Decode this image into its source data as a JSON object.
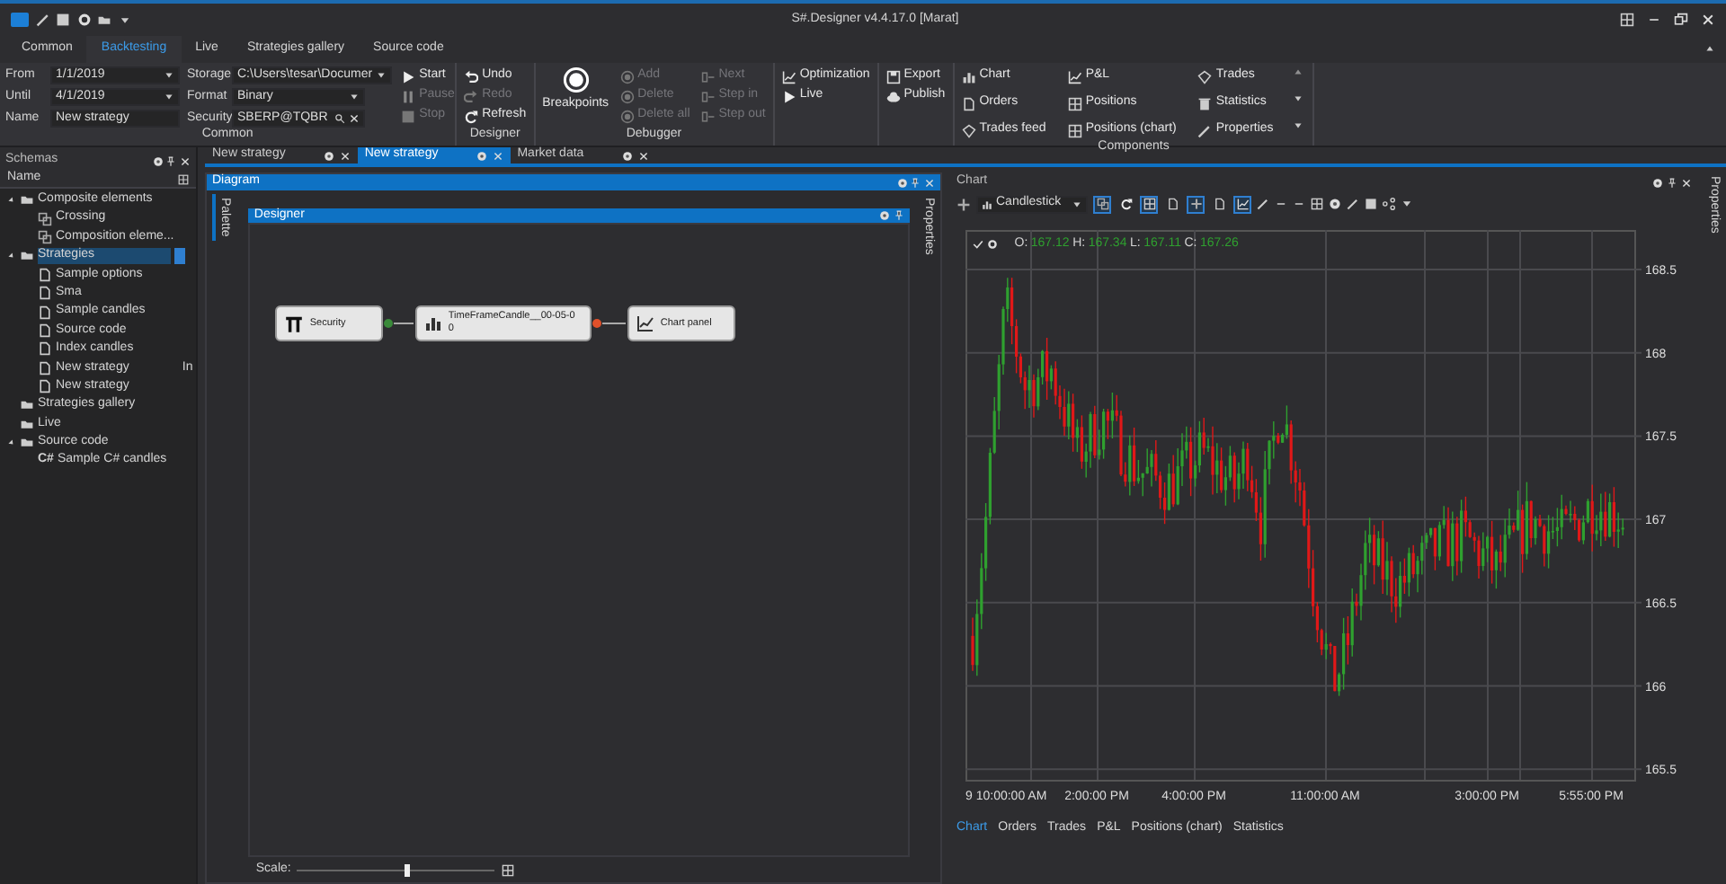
{
  "window": {
    "title": "S#.Designer v4.4.17.0 [Marat]"
  },
  "ribbon_tabs": [
    {
      "label": "Common",
      "selected": false
    },
    {
      "label": "Backtesting",
      "selected": true
    },
    {
      "label": "Live",
      "selected": false
    },
    {
      "label": "Strategies gallery",
      "selected": false
    },
    {
      "label": "Source code",
      "selected": false
    }
  ],
  "ribbon_groups": [
    {
      "kind": "common",
      "title": "Common",
      "fields": [
        {
          "label": "From",
          "value": "1/1/2019",
          "kind": "dropdown"
        },
        {
          "label": "Until",
          "value": "4/1/2019",
          "kind": "dropdown"
        },
        {
          "label": "Name",
          "value": "New strategy",
          "kind": "text"
        },
        {
          "label": "Storage",
          "value": "C:\\Users\\tesar\\Documer",
          "kind": "dropdown"
        },
        {
          "label": "Format",
          "value": "Binary",
          "kind": "dropdown"
        },
        {
          "label": "Security",
          "value": "SBERP@TQBR",
          "kind": "search"
        }
      ],
      "buttons": [
        {
          "label": "Start",
          "disabled": false
        },
        {
          "label": "Pause",
          "disabled": true
        },
        {
          "label": "Stop",
          "disabled": true
        }
      ]
    },
    {
      "kind": "designer",
      "title": "Designer",
      "buttons": [
        {
          "label": "Undo",
          "disabled": false
        },
        {
          "label": "Redo",
          "disabled": true
        },
        {
          "label": "Refresh",
          "disabled": false
        }
      ]
    },
    {
      "kind": "debugger",
      "title": "Debugger",
      "main": "Breakpoints",
      "buttons": [
        {
          "label": "Add",
          "disabled": true
        },
        {
          "label": "Delete",
          "disabled": true
        },
        {
          "label": "Delete all",
          "disabled": true
        },
        {
          "label": "Next",
          "disabled": true
        },
        {
          "label": "Step in",
          "disabled": true
        },
        {
          "label": "Step out",
          "disabled": true
        }
      ]
    },
    {
      "kind": "run",
      "buttons": [
        {
          "label": "Optimization",
          "disabled": false
        },
        {
          "label": "Live",
          "disabled": false
        }
      ]
    },
    {
      "kind": "publish",
      "buttons": [
        {
          "label": "Export",
          "disabled": false
        },
        {
          "label": "Publish",
          "disabled": false
        }
      ]
    },
    {
      "kind": "components",
      "title": "Components",
      "buttons": [
        {
          "label": "Chart",
          "disabled": false
        },
        {
          "label": "P&L",
          "disabled": false
        },
        {
          "label": "Trades",
          "disabled": false
        },
        {
          "label": "Orders",
          "disabled": false
        },
        {
          "label": "Positions",
          "disabled": false
        },
        {
          "label": "Statistics",
          "disabled": false
        },
        {
          "label": "Trades feed",
          "disabled": false
        },
        {
          "label": "Positions (chart)",
          "disabled": false
        },
        {
          "label": "Properties",
          "disabled": false
        }
      ]
    }
  ],
  "schemas": {
    "title": "Schemas",
    "column": "Name",
    "items": [
      {
        "label": "Composite elements",
        "kind": "folder",
        "selected": false,
        "expanded": true,
        "children": [
          {
            "label": "Crossing",
            "kind": "composite",
            "selected": false
          },
          {
            "label": "Composition eleme...",
            "kind": "composite",
            "selected": false
          }
        ]
      },
      {
        "label": "Strategies",
        "kind": "folder",
        "selected": true,
        "expanded": true,
        "children": [
          {
            "label": "Sample options",
            "kind": "document",
            "selected": false
          },
          {
            "label": "Sma",
            "kind": "document",
            "selected": false
          },
          {
            "label": "Sample candles",
            "kind": "document",
            "selected": false
          },
          {
            "label": "Source code",
            "kind": "document",
            "selected": false
          },
          {
            "label": "Index candles",
            "kind": "document",
            "selected": false
          },
          {
            "label": "New strategy",
            "kind": "document",
            "selected": false,
            "extra": "In"
          },
          {
            "label": "New strategy",
            "kind": "document",
            "selected": false
          }
        ]
      },
      {
        "label": "Strategies gallery",
        "kind": "folder",
        "selected": false
      },
      {
        "label": "Live",
        "kind": "folder",
        "selected": false
      },
      {
        "label": "Source code",
        "kind": "folder",
        "selected": false,
        "expanded": true,
        "children": [
          {
            "label": "Sample C# candles",
            "kind": "csharp",
            "badge": "C#",
            "selected": false
          }
        ]
      }
    ]
  },
  "doc_tabs": [
    {
      "label": "New strategy",
      "selected": false
    },
    {
      "label": "New strategy",
      "selected": true
    },
    {
      "label": "Market data",
      "selected": false
    }
  ],
  "diagram": {
    "title": "Diagram",
    "side_tab": "Palette",
    "right_tab": "Properties",
    "designer_title": "Designer",
    "nodes": [
      {
        "kind": "security",
        "label": "Security"
      },
      {
        "kind": "candles",
        "label": "TimeFrameCandle__00-05-0",
        "sublabel": "0"
      },
      {
        "kind": "chart",
        "label": "Chart panel"
      }
    ],
    "scale": {
      "label": "Scale:",
      "level": 0.55
    }
  },
  "chart": {
    "title": "Chart",
    "right_tab": "Properties",
    "style": "Candlestick",
    "toolbar_toggles": [
      {
        "selected": true
      },
      {
        "selected": false
      },
      {
        "selected": true
      },
      {
        "selected": false
      },
      {
        "selected": true
      },
      {
        "selected": false
      },
      {
        "selected": true
      }
    ],
    "legend": [
      {
        "key": "O:",
        "value": "167.12"
      },
      {
        "key": "H:",
        "value": "167.34"
      },
      {
        "key": "L:",
        "value": "167.11"
      },
      {
        "key": "C:",
        "value": "167.26"
      }
    ],
    "y_ticks": [
      "168.5",
      "168",
      "167.5",
      "167",
      "166.5",
      "166",
      "165.5"
    ],
    "x_ticks": [
      "9 10:00:00 AM",
      "2:00:00 PM",
      "4:00:00 PM",
      "11:00:00 AM",
      "3:00:00 PM",
      "5:55:00 PM"
    ],
    "bottom_tabs": [
      {
        "label": "Chart",
        "selected": true
      },
      {
        "label": "Orders",
        "selected": false
      },
      {
        "label": "Trades",
        "selected": false
      },
      {
        "label": "P&L",
        "selected": false
      },
      {
        "label": "Positions (chart)",
        "selected": false
      },
      {
        "label": "Statistics",
        "selected": false
      }
    ]
  }
}
